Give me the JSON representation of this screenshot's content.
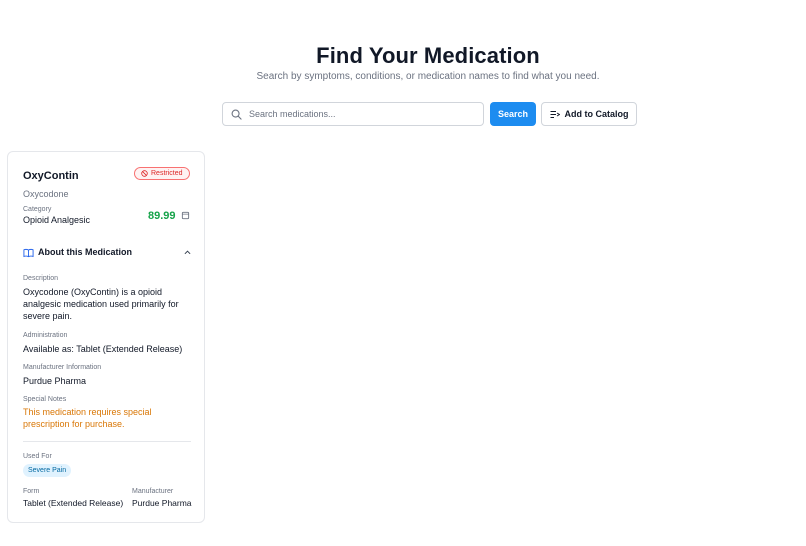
{
  "header": {
    "title": "Find Your Medication",
    "subtitle": "Search by symptoms, conditions, or medication names to find what you need."
  },
  "search": {
    "placeholder": "Search medications...",
    "value": "",
    "button_label": "Search",
    "catalog_button_label": "Add to Catalog"
  },
  "card": {
    "name": "OxyContin",
    "generic_name": "Oxycodone",
    "badge": "Restricted",
    "category_label": "Category",
    "category": "Opioid Analgesic",
    "price": "89.99",
    "about_title": "About this Medication",
    "description_label": "Description",
    "description": "Oxycodone (OxyContin) is a opioid analgesic medication used primarily for severe pain.",
    "administration_label": "Administration",
    "administration": "Available as: Tablet (Extended Release)",
    "manufacturer_info_label": "Manufacturer Information",
    "manufacturer_info": "Purdue Pharma",
    "special_notes_label": "Special Notes",
    "special_notes": "This medication requires special prescription for purchase.",
    "used_for_label": "Used For",
    "used_for": [
      "Severe Pain"
    ],
    "form_label": "Form",
    "form": "Tablet (Extended Release)",
    "manufacturer_label": "Manufacturer",
    "manufacturer": "Purdue Pharma"
  },
  "colors": {
    "primary": "#1d8cf0",
    "price": "#16a34a",
    "restricted": "#dc2626",
    "warning": "#d97706",
    "tag_bg": "#e0f2fe"
  },
  "icons": {
    "search": "search-icon",
    "catalog": "list-add-icon",
    "restricted": "ban-icon",
    "cart": "cart-icon",
    "about": "book-open-icon",
    "collapse": "chevron-up-icon"
  }
}
